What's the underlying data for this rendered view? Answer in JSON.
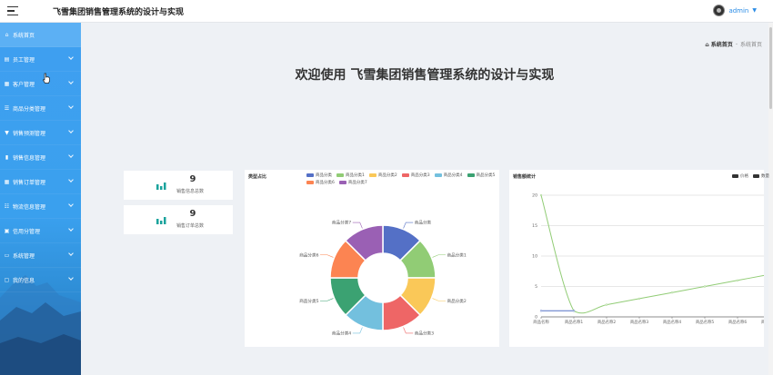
{
  "header": {
    "title": "飞雪集团销售管理系统的设计与实现",
    "user": "admin"
  },
  "sidebar": {
    "items": [
      {
        "label": "系统首页",
        "icon": "home-icon",
        "active": true
      },
      {
        "label": "员工管理",
        "icon": "badge-icon"
      },
      {
        "label": "客户管理",
        "icon": "grid-icon"
      },
      {
        "label": "商品分类管理",
        "icon": "list-icon"
      },
      {
        "label": "销售预测管理",
        "icon": "filter-icon"
      },
      {
        "label": "销售信息管理",
        "icon": "chart-icon"
      },
      {
        "label": "销售订单管理",
        "icon": "grid-icon"
      },
      {
        "label": "物流信息管理",
        "icon": "sliders-icon"
      },
      {
        "label": "信用分管理",
        "icon": "money-icon"
      },
      {
        "label": "系统管理",
        "icon": "monitor-icon"
      },
      {
        "label": "我的信息",
        "icon": "user-card-icon"
      }
    ]
  },
  "breadcrumb": {
    "home": "系统首页",
    "separator": "-",
    "current": "系统首页"
  },
  "welcome": "欢迎使用 飞雪集团销售管理系统的设计与实现",
  "stats": [
    {
      "value": "9",
      "label": "销售信息总数"
    },
    {
      "value": "9",
      "label": "销售订单总数"
    }
  ],
  "colors": {
    "accent": "#3aa0ee",
    "stat_icon": "#1aa39c",
    "palette": [
      "#5470c6",
      "#91cc75",
      "#fac858",
      "#ee6666",
      "#73c0de",
      "#3ba272",
      "#fc8452",
      "#9a60b4"
    ]
  },
  "chart_data": [
    {
      "type": "pie",
      "title": "类型占比",
      "donut": true,
      "categories": [
        "商品分类",
        "商品分类1",
        "商品分类2",
        "商品分类3",
        "商品分类4",
        "商品分类5",
        "商品分类6",
        "商品分类7"
      ],
      "values": [
        1,
        1,
        1,
        1,
        1,
        1,
        1,
        1
      ],
      "legend_placement": "top"
    },
    {
      "type": "line",
      "title": "销售额统计",
      "legend": [
        "价格",
        "数量"
      ],
      "legend_placement": "top-right",
      "categories": [
        "商品名称",
        "商品名称1",
        "商品名称2",
        "商品名称3",
        "商品名称4",
        "商品名称5",
        "商品名称6",
        "商品名称7"
      ],
      "ylim": [
        0,
        20
      ],
      "yticks": [
        "0",
        "5",
        "10",
        "15",
        "20"
      ],
      "grid": true,
      "series": [
        {
          "name": "价格",
          "values": [
            20,
            1,
            2,
            3,
            4,
            5,
            6,
            7
          ],
          "color": "#91cc75",
          "smooth": true
        },
        {
          "name": "数量",
          "values": [
            1,
            1
          ],
          "color": "#5470c6",
          "smooth": false
        }
      ]
    }
  ]
}
